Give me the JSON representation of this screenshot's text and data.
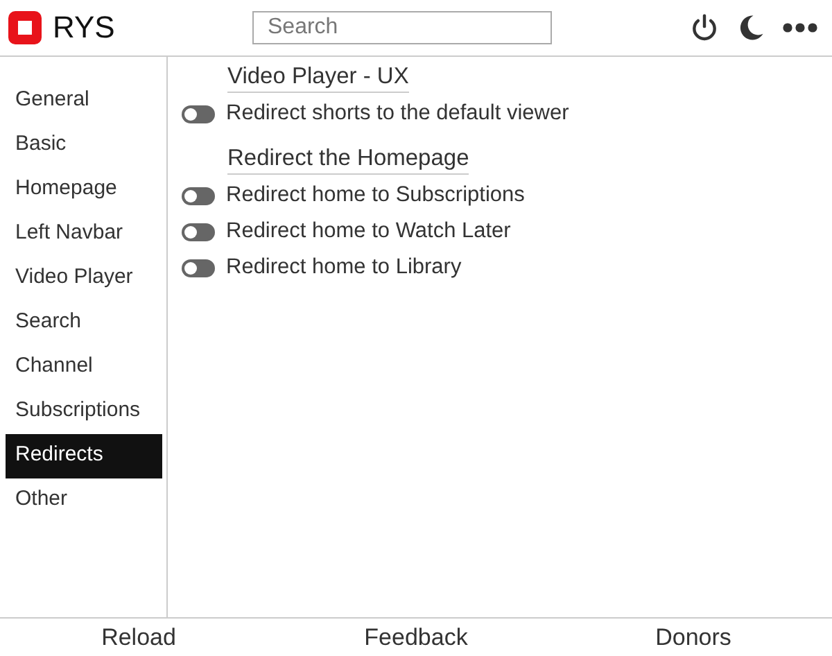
{
  "app": {
    "name": "RYS"
  },
  "search": {
    "placeholder": "Search"
  },
  "sidebar": {
    "items": [
      {
        "label": "General",
        "selected": false
      },
      {
        "label": "Basic",
        "selected": false
      },
      {
        "label": "Homepage",
        "selected": false
      },
      {
        "label": "Left Navbar",
        "selected": false
      },
      {
        "label": "Video Player",
        "selected": false
      },
      {
        "label": "Search",
        "selected": false
      },
      {
        "label": "Channel",
        "selected": false
      },
      {
        "label": "Subscriptions",
        "selected": false
      },
      {
        "label": "Redirects",
        "selected": true
      },
      {
        "label": "Other",
        "selected": false
      }
    ]
  },
  "sections": [
    {
      "title": "Video Player - UX",
      "options": [
        {
          "label": "Redirect shorts to the default viewer",
          "on": false
        }
      ]
    },
    {
      "title": "Redirect the Homepage",
      "options": [
        {
          "label": "Redirect home to Subscriptions",
          "on": false
        },
        {
          "label": "Redirect home to Watch Later",
          "on": false
        },
        {
          "label": "Redirect home to Library",
          "on": false
        }
      ]
    }
  ],
  "footer": [
    "Reload",
    "Feedback",
    "Donors"
  ]
}
